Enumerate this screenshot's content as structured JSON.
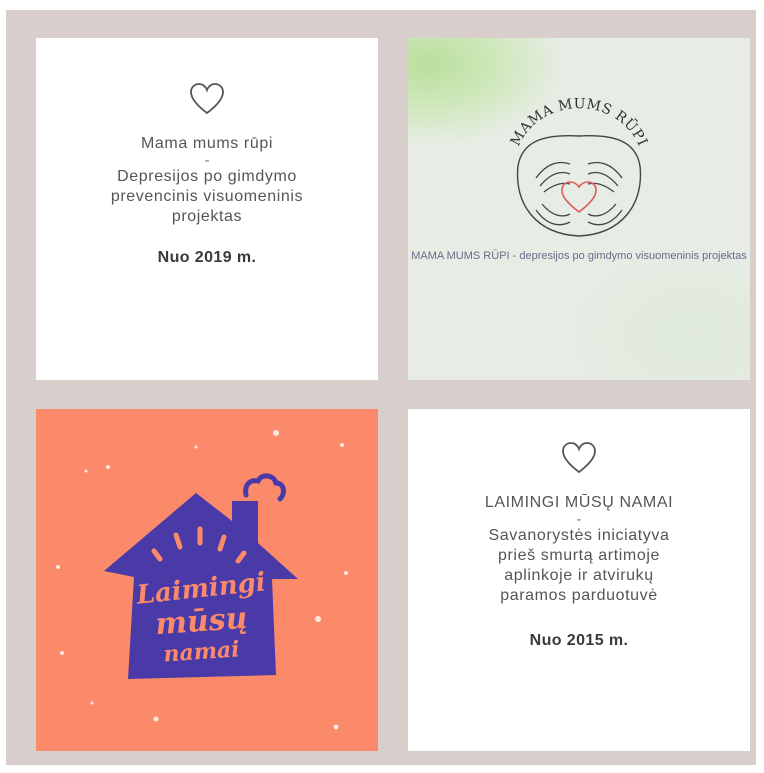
{
  "cards": [
    {
      "title": "Mama mums rūpi",
      "dash": "-",
      "subtitle": "Depresijos po gimdymo prevencinis visuomeninis projektas",
      "year": "Nuo 2019 m.",
      "icon": "heart-outline-icon"
    },
    {
      "logo_text": "MAMA MUMS RŪPI",
      "caption": "MAMA MUMS RŪPI - depresijos po gimdymo visuomeninis projektas",
      "icon": "hands-heart-logo"
    },
    {
      "logo_line1": "Laimingi",
      "logo_line2": "mūsų",
      "logo_line3": "namai",
      "icon": "house-logo"
    },
    {
      "title": "LAIMINGI MŪSŲ NAMAI",
      "dash": "-",
      "subtitle": "Savanorystės iniciatyva prieš smurtą artimoje aplinkoje ir atvirukų paramos parduotuvė",
      "year": "Nuo 2015 m.",
      "icon": "heart-outline-icon"
    }
  ],
  "colors": {
    "frame": "#d8cfcd",
    "coral": "#fb8a6a",
    "house_blue": "#4a3aa8",
    "logo_heart": "#e05a5a"
  }
}
